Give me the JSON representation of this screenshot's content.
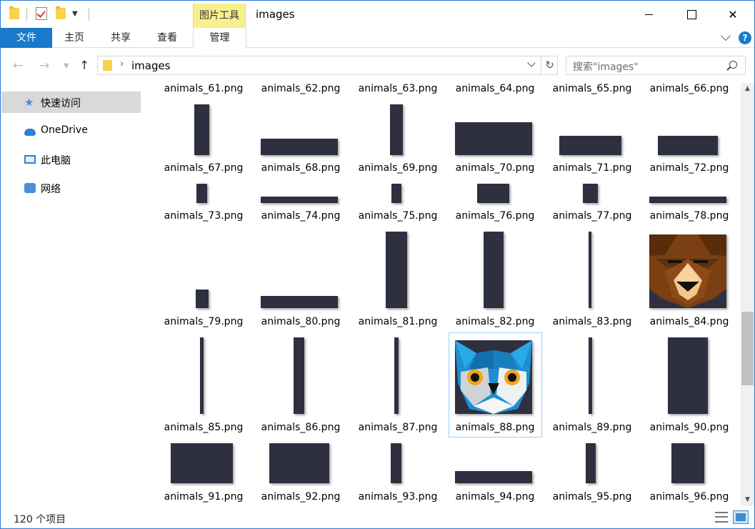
{
  "window": {
    "title": "images"
  },
  "quick_access_toolbar": {
    "icons": [
      "folder-icon",
      "properties-check-icon",
      "new-folder-icon",
      "customize-dropdown-icon"
    ]
  },
  "ribbon": {
    "context_header": "图片工具",
    "tabs": {
      "file": "文件",
      "home": "主页",
      "share": "共享",
      "view": "查看",
      "manage": "管理"
    },
    "help": "?"
  },
  "address_bar": {
    "path": "images",
    "search_placeholder": "搜索\"images\""
  },
  "nav_pane": {
    "items": [
      {
        "label": "快速访问",
        "icon": "star-icon"
      },
      {
        "label": "OneDrive",
        "icon": "cloud-icon"
      },
      {
        "label": "此电脑",
        "icon": "computer-icon"
      },
      {
        "label": "网络",
        "icon": "network-icon"
      }
    ]
  },
  "files": {
    "row0": [
      "animals_61.png",
      "animals_62.png",
      "animals_63.png",
      "animals_64.png",
      "animals_65.png",
      "animals_66.png"
    ],
    "row1": [
      "animals_67.png",
      "animals_68.png",
      "animals_69.png",
      "animals_70.png",
      "animals_71.png",
      "animals_72.png"
    ],
    "row2": [
      "animals_73.png",
      "animals_74.png",
      "animals_75.png",
      "animals_76.png",
      "animals_77.png",
      "animals_78.png"
    ],
    "row3": [
      "animals_79.png",
      "animals_80.png",
      "animals_81.png",
      "animals_82.png",
      "animals_83.png",
      "animals_84.png"
    ],
    "row4": [
      "animals_85.png",
      "animals_86.png",
      "animals_87.png",
      "animals_88.png",
      "animals_89.png",
      "animals_90.png"
    ],
    "row5": [
      "animals_91.png",
      "animals_92.png",
      "animals_93.png",
      "animals_94.png",
      "animals_95.png",
      "animals_96.png"
    ],
    "selected": "animals_88.png"
  },
  "status_bar": {
    "item_count": "120 个项目"
  },
  "colors": {
    "accent": "#1979ca",
    "thumb_dark": "#2e3040",
    "selection_border": "#99d1ff",
    "context_tab": "#f8f08f"
  }
}
